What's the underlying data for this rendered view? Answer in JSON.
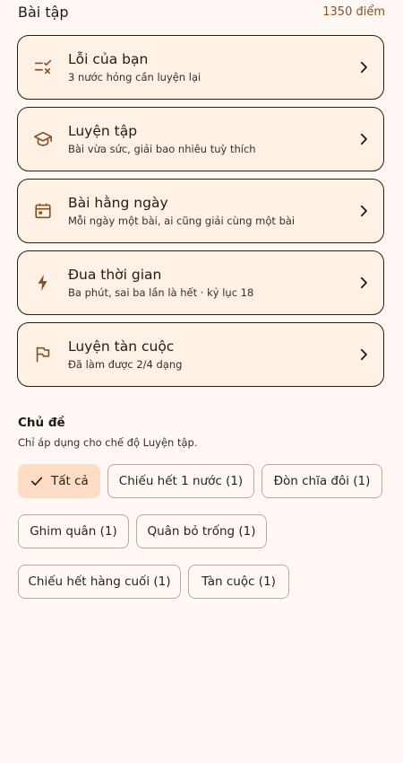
{
  "header": {
    "title": "Bài tập",
    "score": "1350 điểm"
  },
  "cards": [
    {
      "title": "Lỗi của bạn",
      "subtitle": "3 nước hỏng cần luyện lại",
      "icon": "rule-check-icon"
    },
    {
      "title": "Luyện tập",
      "subtitle": "Bài vừa sức, giải bao nhiêu tuỳ thích",
      "icon": "school-cap-icon"
    },
    {
      "title": "Bài hằng ngày",
      "subtitle": "Mỗi ngày một bài, ai cũng giải cùng một bài",
      "icon": "calendar-icon"
    },
    {
      "title": "Đua thời gian",
      "subtitle": "Ba phút, sai ba lần là hết · kỷ lục 18",
      "icon": "bolt-icon"
    },
    {
      "title": "Luyện tàn cuộc",
      "subtitle": "Đã làm được 2/4 dạng",
      "icon": "flag-icon"
    }
  ],
  "topics": {
    "title": "Chủ đề",
    "subtitle": "Chỉ áp dụng cho chế độ Luyện tập.",
    "chips": [
      {
        "label": "Tất cả",
        "selected": true
      },
      {
        "label": "Chiếu hết 1 nước (1)",
        "selected": false
      },
      {
        "label": "Đòn chĩa đôi (1)",
        "selected": false
      },
      {
        "label": "Ghim quân (1)",
        "selected": false
      },
      {
        "label": "Quân bỏ trống (1)",
        "selected": false
      },
      {
        "label": "Chiếu hết hàng cuối (1)",
        "selected": false
      },
      {
        "label": "Tàn cuộc (1)",
        "selected": false
      }
    ]
  },
  "colors": {
    "accent": "#8a5120",
    "card_bg": "#fff1e5",
    "chip_selected": "#fedcc6",
    "page_bg": "#fff8f5"
  }
}
